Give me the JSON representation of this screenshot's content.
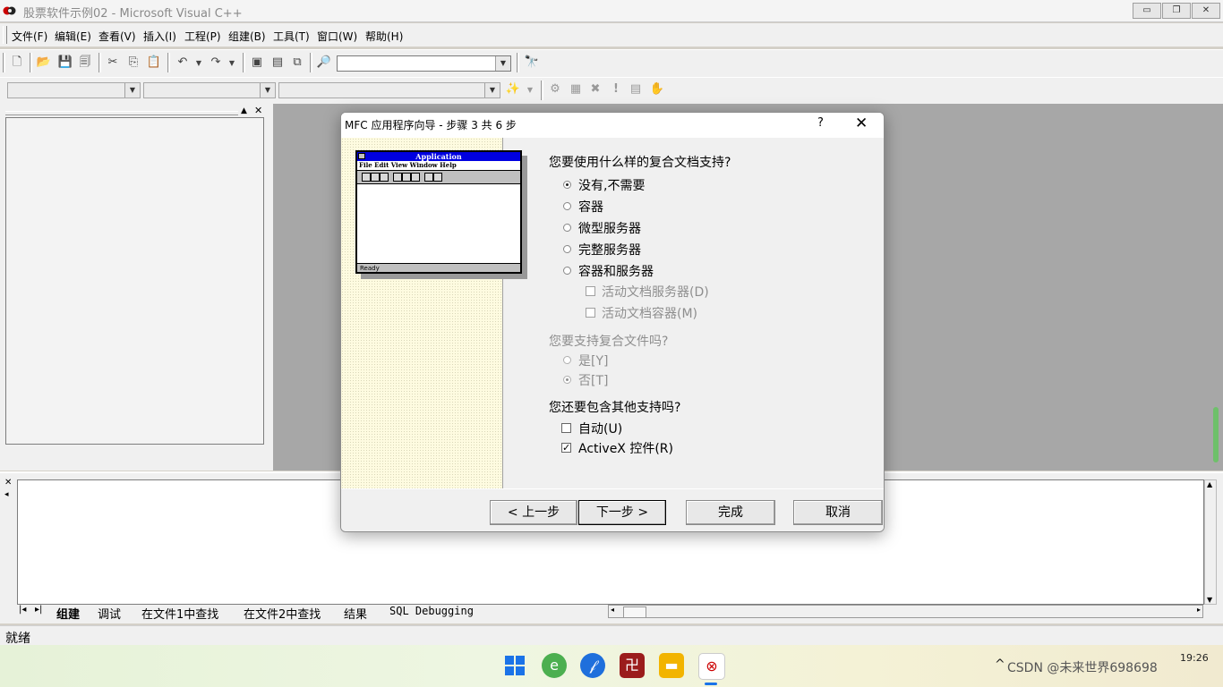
{
  "window": {
    "title": "股票软件示例02 - Microsoft Visual C++",
    "minimize_glyph": "▭",
    "restore_glyph": "❐",
    "close_glyph": "✕"
  },
  "menu": {
    "items": [
      "文件(F)",
      "编辑(E)",
      "查看(V)",
      "插入(I)",
      "工程(P)",
      "组建(B)",
      "工具(T)",
      "窗口(W)",
      "帮助(H)"
    ]
  },
  "toolbar": {
    "find_combo_value": "",
    "wizard_combos": [
      "",
      "",
      ""
    ]
  },
  "dialog": {
    "title": "MFC 应用程序向导 - 步骤 3 共 6 步",
    "help_glyph": "?",
    "close_glyph": "✕",
    "preview": {
      "app_title": "Application",
      "menu": "File  Edit  View  Window  Help",
      "status": "Ready"
    },
    "q1": "您要使用什么样的复合文档支持?",
    "q1_options": [
      "没有,不需要",
      "容器",
      "微型服务器",
      "完整服务器",
      "容器和服务器"
    ],
    "q1_selected": "没有,不需要",
    "sub_options": [
      "活动文档服务器(D)",
      "活动文档容器(M)"
    ],
    "q2": "您要支持复合文件吗?",
    "q2_options": [
      "是[Y]",
      "否[T]"
    ],
    "q2_selected": "否[T]",
    "q3": "您还要包含其他支持吗?",
    "q3_options": [
      "自动(U)",
      "ActiveX 控件(R)"
    ],
    "q3_checked": [
      "ActiveX 控件(R)"
    ],
    "buttons": {
      "back": "< 上一步",
      "next": "下一步 >",
      "finish": "完成",
      "cancel": "取消"
    }
  },
  "output": {
    "tabs": [
      "组建",
      "调试",
      "在文件1中查找",
      "在文件2中查找",
      "结果",
      "SQL Debugging"
    ],
    "active_tab": "组建"
  },
  "status": {
    "text": "就绪"
  },
  "taskbar": {
    "clock_time": "19:26",
    "watermark": "CSDN @未来世界698698"
  },
  "colors": {
    "preview_titlebar": "#0000e0",
    "wizard_panel": "#fefbe0",
    "mdi_background": "#a7a7a7"
  }
}
